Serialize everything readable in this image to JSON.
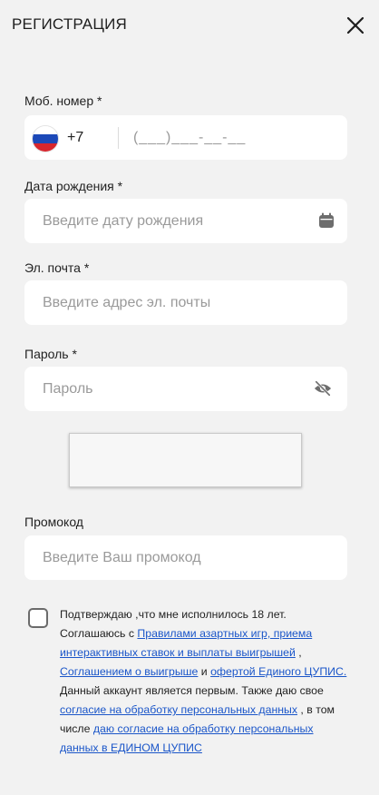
{
  "header": {
    "title": "Регистрация"
  },
  "phone": {
    "label": "Моб. номер *",
    "prefix": "+7",
    "placeholder": "(___)___-__-__"
  },
  "birthdate": {
    "label": "Дата рождения *",
    "placeholder": "Введите дату рождения"
  },
  "email": {
    "label": "Эл. почта *",
    "placeholder": "Введите адрес эл. почты"
  },
  "password": {
    "label": "Пароль *",
    "placeholder": "Пароль"
  },
  "promo": {
    "label": "Промокод",
    "placeholder": "Введите Ваш промокод"
  },
  "consent": {
    "t1": "Подтверждаю ,что мне исполнилось 18 лет. Соглашаюсь с ",
    "link_rules": "Правилами азартных игр, приема интерактивных ставок и выплаты выигрышей",
    "t2": " , ",
    "link_winnings": "Соглашением о выигрыше",
    "t3": "  и ",
    "link_offer": "офертой Единого ЦУПИС.",
    "t4": " Данный аккаунт является первым. Также даю свое ",
    "link_personal": "согласие на обработку персональных данных",
    "t5": " , в том числе ",
    "link_cupis": "даю согласие на обработку персональных данных в ЕДИНОМ  ЦУПИС"
  },
  "colors": {
    "background": "#f2f2f2",
    "field": "#ffffff",
    "link": "#1b56c9",
    "icon": "#6d6d6d"
  }
}
